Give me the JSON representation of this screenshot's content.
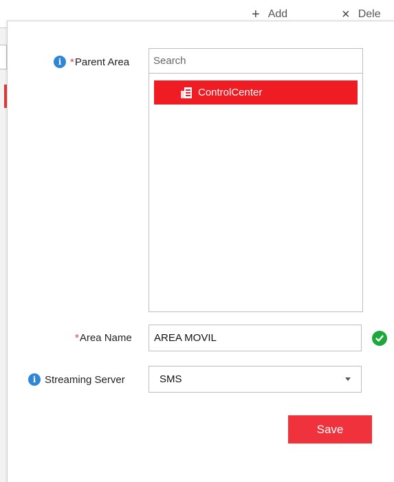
{
  "toolbar": {
    "add_label": "Add",
    "delete_label": "Dele"
  },
  "form": {
    "parent_area": {
      "label": "Parent Area",
      "required_mark": "*",
      "search_placeholder": "Search",
      "tree": [
        {
          "label": "ControlCenter",
          "selected": true,
          "icon": "building-icon"
        }
      ]
    },
    "area_name": {
      "label": "Area Name",
      "required_mark": "*",
      "value": "AREA MOVIL",
      "valid": true
    },
    "streaming_server": {
      "label": "Streaming Server",
      "selected": "SMS"
    },
    "save_label": "Save"
  },
  "colors": {
    "accent": "#ef1c23",
    "info": "#2f86d8",
    "valid": "#1ea83c"
  }
}
